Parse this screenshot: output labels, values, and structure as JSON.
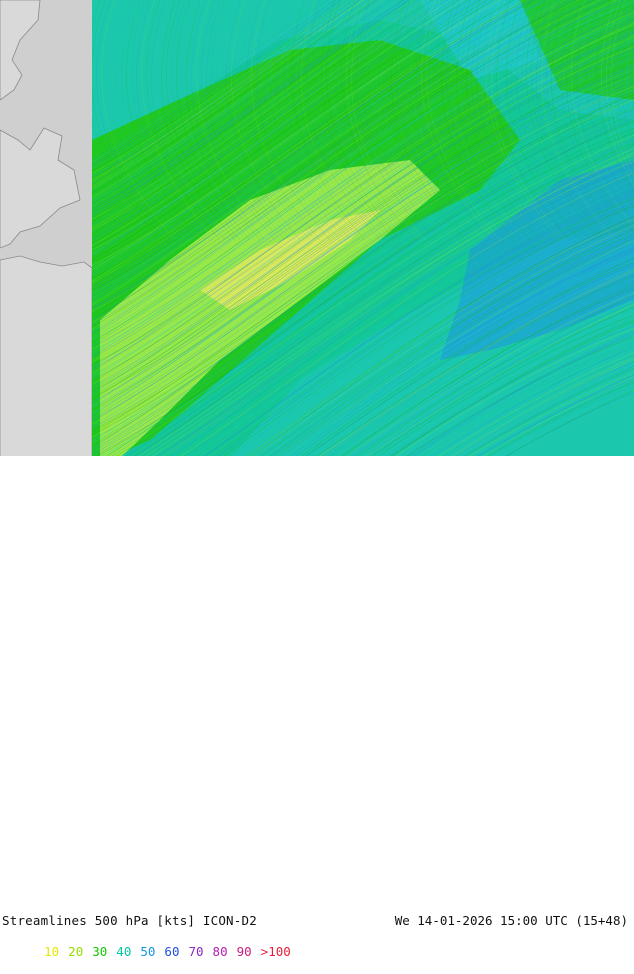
{
  "map": {
    "colors": {
      "land": "#cfcfcf",
      "land_edge": "#8a8a8a",
      "band_dark_green": "#20c820",
      "band_light_green": "#99e84a",
      "band_yellow": "#d9e85c",
      "band_cyan": "#20c8b4",
      "band_teal": "#14c896",
      "band_blue": "#1e96e6"
    }
  },
  "footer": {
    "title": "Streamlines 500 hPa [kts] ICON-D2",
    "run": "We 14-01-2026 15:00 UTC (15+48)"
  },
  "legend": {
    "items": [
      {
        "label": "10",
        "color": "#e6e600"
      },
      {
        "label": "20",
        "color": "#96dc00"
      },
      {
        "label": "30",
        "color": "#14c800"
      },
      {
        "label": "40",
        "color": "#00c8a0"
      },
      {
        "label": "50",
        "color": "#1496dc"
      },
      {
        "label": "60",
        "color": "#1e50dc"
      },
      {
        "label": "70",
        "color": "#8c28c8"
      },
      {
        "label": "80",
        "color": "#b41eb4"
      },
      {
        "label": "90",
        "color": "#c81e78"
      },
      {
        "label": ">100",
        "color": "#e61e3c"
      }
    ]
  }
}
